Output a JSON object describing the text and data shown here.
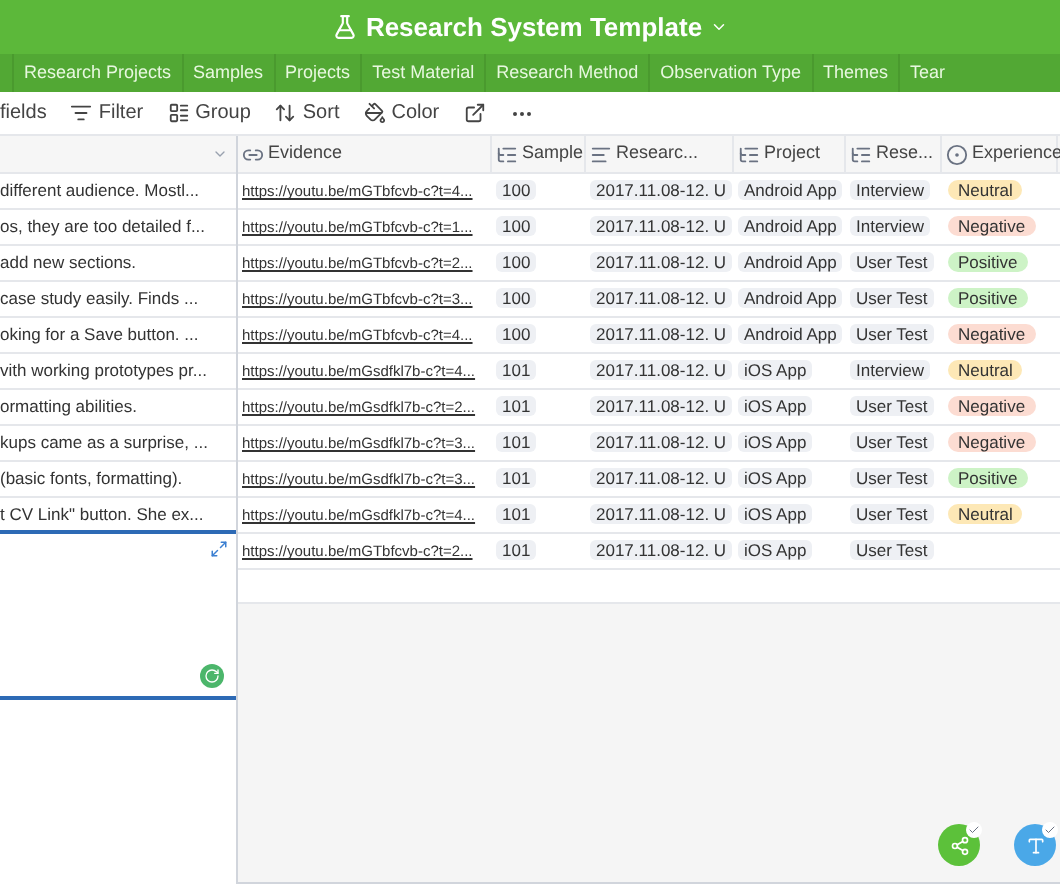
{
  "window": {
    "title": "Research System Template"
  },
  "tabs": [
    {
      "label": "Research Projects",
      "selected": false
    },
    {
      "label": "Samples",
      "selected": false
    },
    {
      "label": "Projects",
      "selected": false
    },
    {
      "label": "Test Material",
      "selected": false
    },
    {
      "label": "Research Method",
      "selected": false
    },
    {
      "label": "Observation Type",
      "selected": false
    },
    {
      "label": "Themes",
      "selected": false
    },
    {
      "label": "Tear",
      "selected": false
    }
  ],
  "toolbar": [
    {
      "kind": "fields",
      "label": "fields"
    },
    {
      "kind": "filter",
      "label": "Filter"
    },
    {
      "kind": "group",
      "label": "Group"
    },
    {
      "kind": "sort",
      "label": "Sort"
    },
    {
      "kind": "color",
      "label": "Color"
    },
    {
      "kind": "share"
    },
    {
      "kind": "more"
    }
  ],
  "columns": [
    {
      "kind": "primary"
    },
    {
      "kind": "url",
      "label": "Evidence"
    },
    {
      "kind": "text",
      "label": "Sample"
    },
    {
      "kind": "long",
      "label": "Researc..."
    },
    {
      "kind": "text",
      "label": "Project"
    },
    {
      "kind": "text",
      "label": "Rese..."
    },
    {
      "kind": "select",
      "label": "Experience"
    }
  ],
  "rows": [
    {
      "note": "different audience. Mostl...",
      "evidence": "https://youtu.be/mGTbfcvb-c?t=4...",
      "sample": "100",
      "research": "2017.11.08-12. U",
      "project": "Android App",
      "method": "Interview",
      "experience": {
        "label": "Neutral",
        "color": "#fde8b6"
      }
    },
    {
      "note": "os, they are too detailed f...",
      "evidence": "https://youtu.be/mGTbfcvb-c?t=1...",
      "sample": "100",
      "research": "2017.11.08-12. U",
      "project": "Android App",
      "method": "Interview",
      "experience": {
        "label": "Negative",
        "color": "#fcdcd2"
      }
    },
    {
      "note": "add new sections.",
      "evidence": "https://youtu.be/mGTbfcvb-c?t=2...",
      "sample": "100",
      "research": "2017.11.08-12. U",
      "project": "Android App",
      "method": "User Test",
      "experience": {
        "label": "Positive",
        "color": "#cdf3c6"
      }
    },
    {
      "note": "case study easily. Finds ...",
      "evidence": "https://youtu.be/mGTbfcvb-c?t=3...",
      "sample": "100",
      "research": "2017.11.08-12. U",
      "project": "Android App",
      "method": "User Test",
      "experience": {
        "label": "Positive",
        "color": "#cdf3c6"
      }
    },
    {
      "note": "oking for a Save button. ...",
      "evidence": "https://youtu.be/mGTbfcvb-c?t=4...",
      "sample": "100",
      "research": "2017.11.08-12. U",
      "project": "Android App",
      "method": "User Test",
      "experience": {
        "label": "Negative",
        "color": "#fcdcd2"
      }
    },
    {
      "note": "vith working prototypes pr...",
      "evidence": "https://youtu.be/mGsdfkl7b-c?t=4...",
      "sample": "101",
      "research": "2017.11.08-12. U",
      "project": "iOS App",
      "method": "Interview",
      "experience": {
        "label": "Neutral",
        "color": "#fde8b6"
      }
    },
    {
      "note": "ormatting abilities.",
      "evidence": "https://youtu.be/mGsdfkl7b-c?t=2...",
      "sample": "101",
      "research": "2017.11.08-12. U",
      "project": "iOS App",
      "method": "User Test",
      "experience": {
        "label": "Negative",
        "color": "#fcdcd2"
      }
    },
    {
      "note": "kups came as a surprise, ...",
      "evidence": "https://youtu.be/mGsdfkl7b-c?t=3...",
      "sample": "101",
      "research": "2017.11.08-12. U",
      "project": "iOS App",
      "method": "User Test",
      "experience": {
        "label": "Negative",
        "color": "#fcdcd2"
      }
    },
    {
      "note": "(basic fonts, formatting).",
      "evidence": "https://youtu.be/mGsdfkl7b-c?t=3...",
      "sample": "101",
      "research": "2017.11.08-12. U",
      "project": "iOS App",
      "method": "User Test",
      "experience": {
        "label": "Positive",
        "color": "#cdf3c6"
      }
    },
    {
      "note": "t CV Link\" button. She ex...",
      "evidence": "https://youtu.be/mGsdfkl7b-c?t=4...",
      "sample": "101",
      "research": "2017.11.08-12. U",
      "project": "iOS App",
      "method": "User Test",
      "experience": {
        "label": "Neutral",
        "color": "#fde8b6"
      }
    },
    {
      "evidence": "https://youtu.be/mGTbfcvb-c?t=2...",
      "sample": "101",
      "research": "2017.11.08-12. U",
      "project": "iOS App",
      "method": "User Test"
    }
  ]
}
